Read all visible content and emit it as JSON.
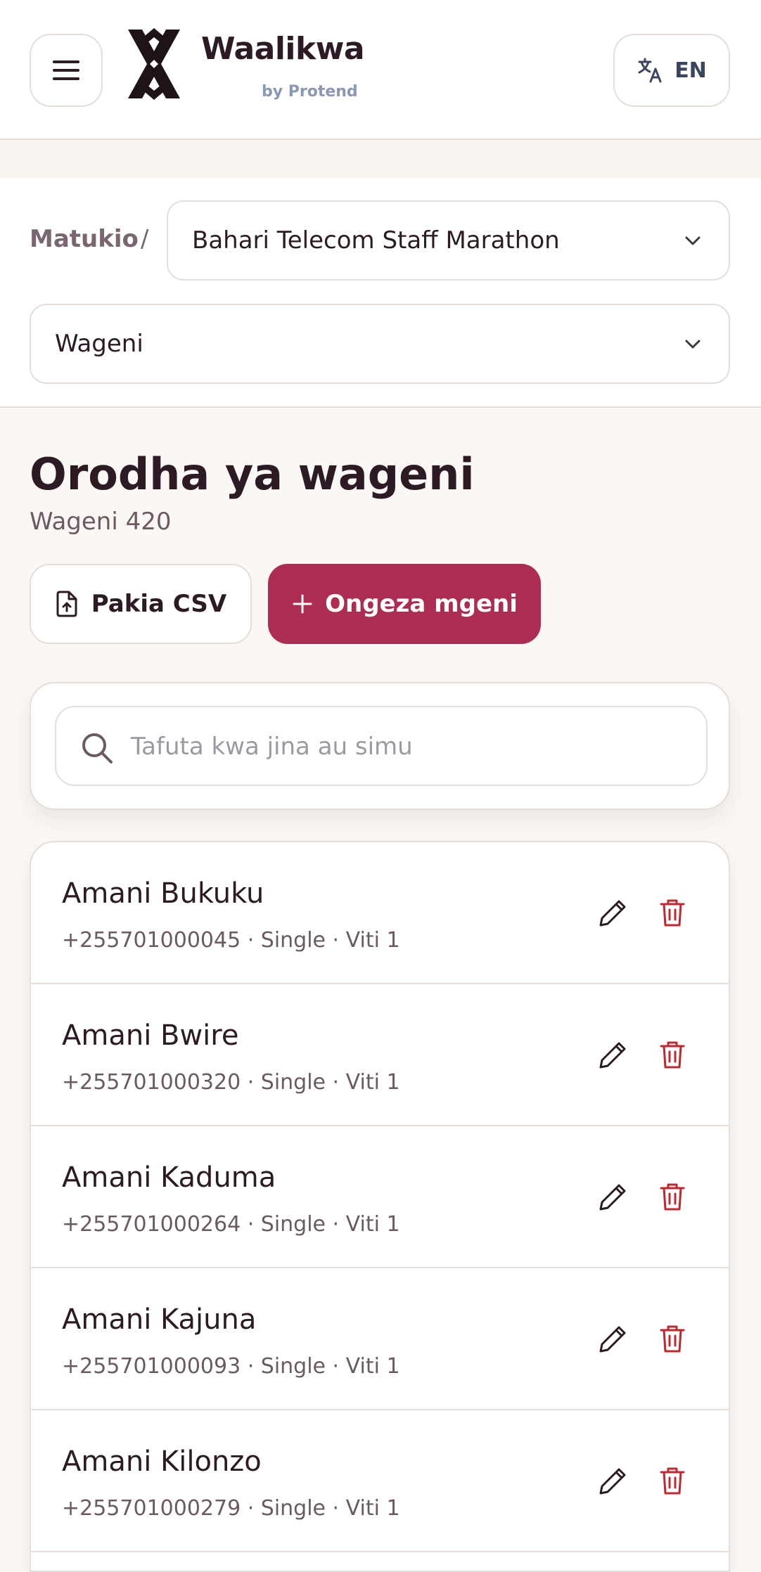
{
  "header": {
    "brand_name": "Waalikwa",
    "brand_sub": "by Protend",
    "language": "EN"
  },
  "nav": {
    "crumb": "Matukio",
    "separator": "/",
    "event_select": "Bahari Telecom Staff Marathon",
    "section_select": "Wageni"
  },
  "main": {
    "title": "Orodha ya wageni",
    "count": "Wageni 420",
    "csv_button": "Pakia CSV",
    "add_button": "Ongeza mgeni",
    "search_placeholder": "Tafuta kwa jina au simu"
  },
  "guests": [
    {
      "name": "Amani Bukuku",
      "meta": "+255701000045 · Single · Viti 1"
    },
    {
      "name": "Amani Bwire",
      "meta": "+255701000320 · Single · Viti 1"
    },
    {
      "name": "Amani Kaduma",
      "meta": "+255701000264 · Single · Viti 1"
    },
    {
      "name": "Amani Kajuna",
      "meta": "+255701000093 · Single · Viti 1"
    },
    {
      "name": "Amani Kilonzo",
      "meta": "+255701000279 · Single · Viti 1"
    }
  ],
  "colors": {
    "accent": "#ad2d52",
    "delete": "#c0282f",
    "border": "#e6ded8"
  },
  "icons": {
    "menu": "hamburger-menu-icon",
    "logo": "waalikwa-logo-icon",
    "language": "translate-icon",
    "chevron": "chevron-down-icon",
    "upload": "file-upload-icon",
    "add": "plus-icon",
    "search": "search-icon",
    "edit": "pencil-icon",
    "delete": "trash-icon"
  }
}
